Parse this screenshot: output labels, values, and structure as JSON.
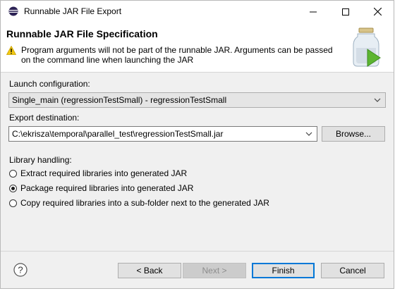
{
  "window": {
    "title": "Runnable JAR File Export",
    "controls": {
      "minimize": "—",
      "maximize": "☐",
      "close": "✕"
    }
  },
  "header": {
    "title": "Runnable JAR File Specification",
    "message": "Program arguments will not be part of the runnable JAR. Arguments can be passed on the command line when launching the JAR"
  },
  "launch": {
    "label": "Launch configuration:",
    "value": "Single_main (regressionTestSmall) - regressionTestSmall"
  },
  "export": {
    "label": "Export destination:",
    "value": "C:\\ekrisza\\temporal\\parallel_test\\regressionTestSmall.jar",
    "browse_label": "Browse..."
  },
  "library": {
    "label": "Library handling:",
    "options": [
      {
        "label": "Extract required libraries into generated JAR",
        "selected": false
      },
      {
        "label": "Package required libraries into generated JAR",
        "selected": true
      },
      {
        "label": "Copy required libraries into a sub-folder next to the generated JAR",
        "selected": false
      }
    ]
  },
  "footer": {
    "help_glyph": "?",
    "back_label": "< Back",
    "next_label": "Next >",
    "finish_label": "Finish",
    "cancel_label": "Cancel"
  },
  "colors": {
    "accent": "#0078d7",
    "warning": "#f2c811",
    "dialog_bg": "#f0f0f0"
  }
}
